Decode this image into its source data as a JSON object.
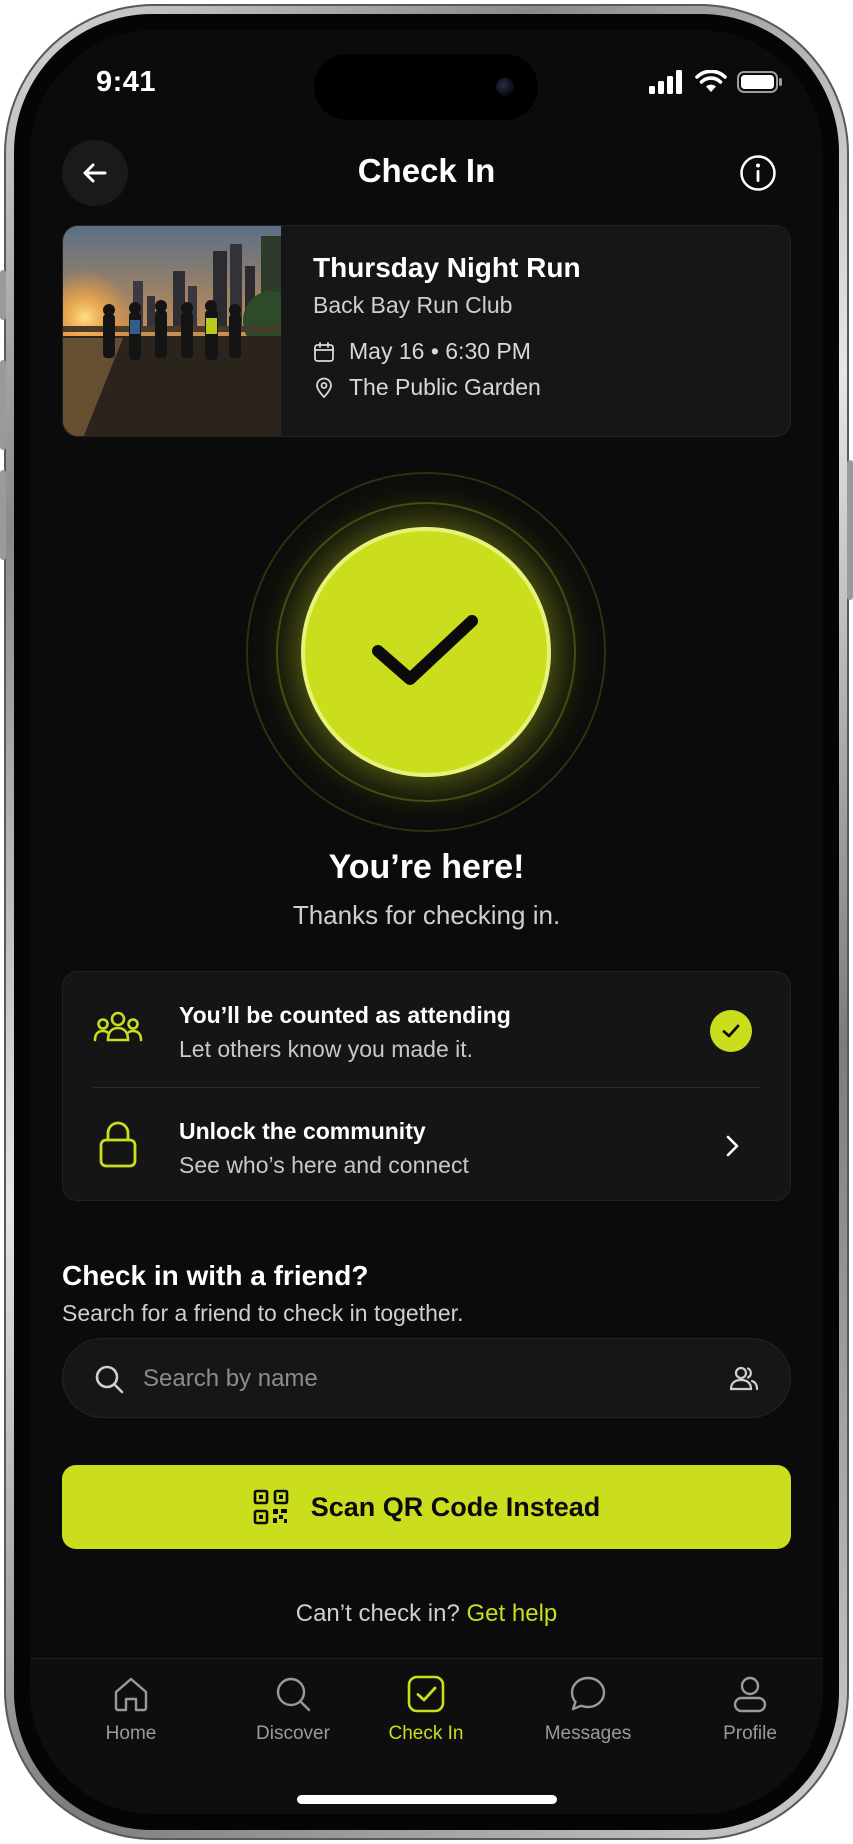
{
  "status_bar": {
    "time": "9:41"
  },
  "header": {
    "title": "Check In"
  },
  "event": {
    "title": "Thursday Night Run",
    "club": "Back Bay Run Club",
    "date_time": "May 16 • 6:30 PM",
    "location": "The Public Garden"
  },
  "success": {
    "title": "You’re here!",
    "subtitle": "Thanks for checking in."
  },
  "info_items": [
    {
      "title": "You’ll be counted as attending",
      "description": "Let others know you made it.",
      "icon": "group-icon",
      "trailing": "check-badge-icon"
    },
    {
      "title": "Unlock the community",
      "description": "See who’s here and connect",
      "icon": "lock-icon",
      "trailing": "chevron-right-icon"
    }
  ],
  "friend": {
    "title": "Check in with a friend?",
    "subtitle": "Search for a friend to check in together.",
    "search_placeholder": "Search by name",
    "search_value": ""
  },
  "scan_button": {
    "label": "Scan QR Code Instead"
  },
  "help": {
    "prompt": "Can’t check in?",
    "link": "Get help"
  },
  "tabs": [
    {
      "label": "Home",
      "icon": "home-icon",
      "active": false
    },
    {
      "label": "Discover",
      "icon": "search-icon",
      "active": false
    },
    {
      "label": "Check In",
      "icon": "check-square-icon",
      "active": true
    },
    {
      "label": "Messages",
      "icon": "chat-icon",
      "active": false
    },
    {
      "label": "Profile",
      "icon": "person-icon",
      "active": false
    }
  ],
  "colors": {
    "accent": "#cade1d",
    "background": "#0b0b0b",
    "card": "#161616"
  }
}
